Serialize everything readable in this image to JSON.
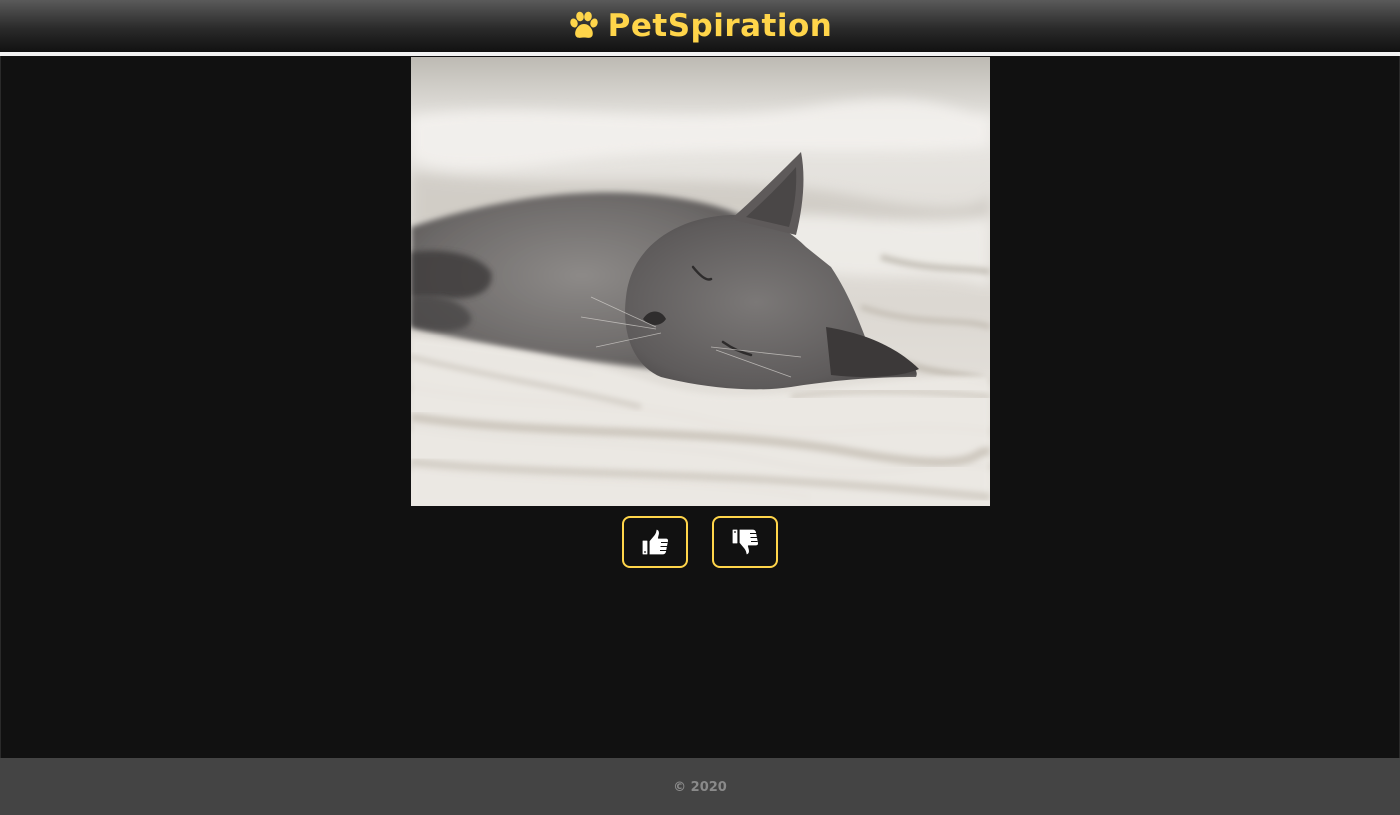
{
  "header": {
    "brand_name": "PetSpiration",
    "brand_icon": "paw-icon",
    "accent_color": "#ffd54a"
  },
  "main": {
    "photo_subject": "cat-photo",
    "vote_buttons": [
      {
        "icon": "thumbs-up-icon"
      },
      {
        "icon": "thumbs-down-icon"
      }
    ]
  },
  "footer": {
    "copyright": "© 2020"
  },
  "colors": {
    "background": "#111111",
    "footer_background": "#444444",
    "footer_text": "#8a8a8a"
  }
}
